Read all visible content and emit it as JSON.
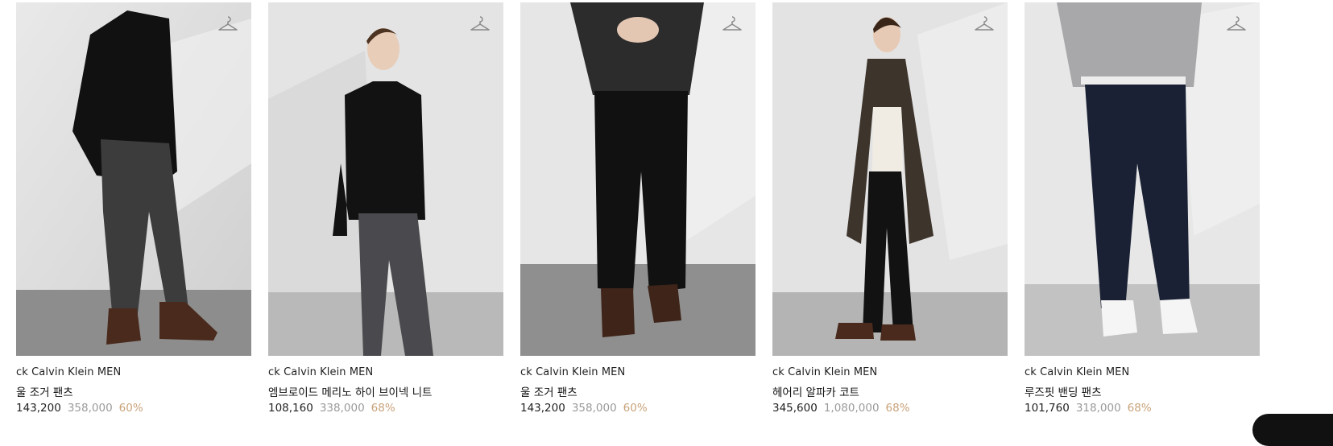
{
  "products": [
    {
      "brand": "ck Calvin Klein MEN",
      "name": "울 조거 팬츠",
      "price": "143,200",
      "original_price": "358,000",
      "discount": "60%"
    },
    {
      "brand": "ck Calvin Klein MEN",
      "name": "엠브로이드 메리노 하이 브이넥 니트",
      "price": "108,160",
      "original_price": "338,000",
      "discount": "68%"
    },
    {
      "brand": "ck Calvin Klein MEN",
      "name": "울 조거 팬츠",
      "price": "143,200",
      "original_price": "358,000",
      "discount": "60%"
    },
    {
      "brand": "ck Calvin Klein MEN",
      "name": "헤어리 알파카 코트",
      "price": "345,600",
      "original_price": "1,080,000",
      "discount": "68%"
    },
    {
      "brand": "ck Calvin Klein MEN",
      "name": "루즈핏 밴딩 팬츠",
      "price": "101,760",
      "original_price": "318,000",
      "discount": "68%"
    }
  ],
  "icons": {
    "wishlist": "hanger-icon"
  },
  "colors": {
    "discount": "#c8a27a",
    "original_price": "#9a9a9a",
    "price": "#222222"
  }
}
